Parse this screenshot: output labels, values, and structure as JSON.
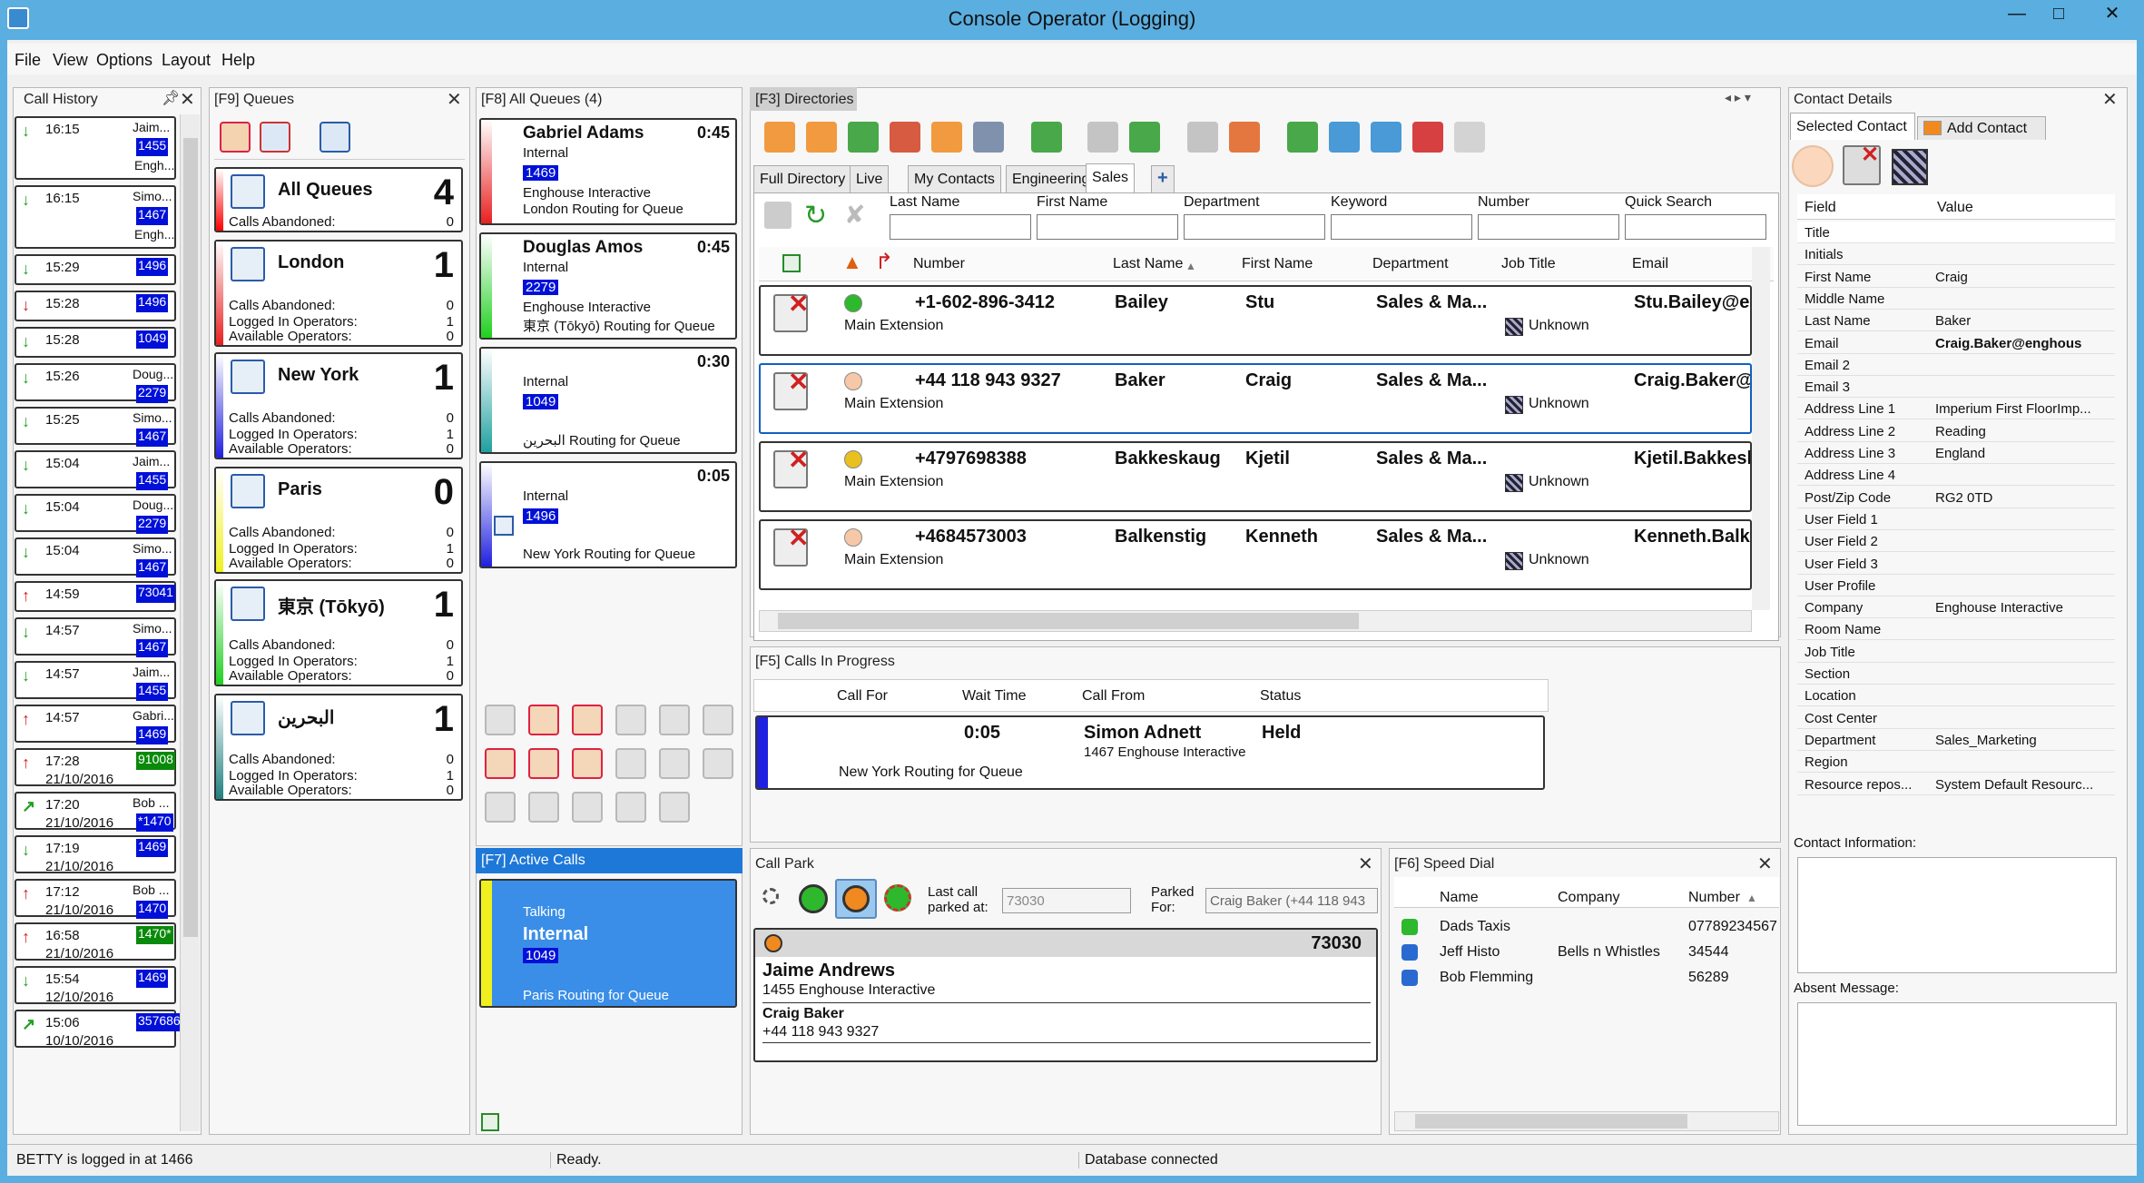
{
  "window": {
    "title": "Console Operator (Logging)",
    "minimize": "—",
    "maximize": "□",
    "close": "✕"
  },
  "menu": [
    "File",
    "View",
    "Options",
    "Layout",
    "Help"
  ],
  "call_history": {
    "title": "Call History",
    "items": [
      {
        "dir": "in",
        "time": "16:15",
        "name": "Jaim...",
        "badge": "1455",
        "sub": "Engh..."
      },
      {
        "dir": "in",
        "time": "16:15",
        "name": "Simo...",
        "badge": "1467",
        "sub": "Engh..."
      },
      {
        "dir": "in",
        "time": "15:29",
        "badge": "1496"
      },
      {
        "dir": "in-red",
        "time": "15:28",
        "badge": "1496"
      },
      {
        "dir": "in",
        "time": "15:28",
        "badge": "1049"
      },
      {
        "dir": "in",
        "time": "15:26",
        "name": "Doug...",
        "badge": "2279"
      },
      {
        "dir": "in",
        "time": "15:25",
        "name": "Simo...",
        "badge": "1467"
      },
      {
        "dir": "in",
        "time": "15:04",
        "name": "Jaim...",
        "badge": "1455"
      },
      {
        "dir": "in",
        "time": "15:04",
        "name": "Doug...",
        "badge": "2279"
      },
      {
        "dir": "in",
        "time": "15:04",
        "name": "Simo...",
        "badge": "1467"
      },
      {
        "dir": "out",
        "time": "14:59",
        "badge": "73041"
      },
      {
        "dir": "in",
        "time": "14:57",
        "name": "Simo...",
        "badge": "1467"
      },
      {
        "dir": "in",
        "time": "14:57",
        "name": "Jaim...",
        "badge": "1455"
      },
      {
        "dir": "out",
        "time": "14:57",
        "name": "Gabri...",
        "badge": "1469"
      },
      {
        "dir": "out",
        "time": "17:28",
        "date": "21/10/2016",
        "badge": "91008",
        "badge_color": "#0a8a0a"
      },
      {
        "dir": "out-green",
        "time": "17:20",
        "date": "21/10/2016",
        "name": "Bob ...",
        "badge": "*1470"
      },
      {
        "dir": "in",
        "time": "17:19",
        "date": "21/10/2016",
        "badge": "1469"
      },
      {
        "dir": "out",
        "time": "17:12",
        "date": "21/10/2016",
        "name": "Bob ...",
        "badge": "1470"
      },
      {
        "dir": "out",
        "time": "16:58",
        "date": "21/10/2016",
        "badge": "1470*",
        "badge_color": "#0a8a0a"
      },
      {
        "dir": "in",
        "time": "15:54",
        "date": "12/10/2016",
        "badge": "1469"
      },
      {
        "dir": "out-green",
        "time": "15:06",
        "date": "10/10/2016",
        "badge": "357686"
      }
    ]
  },
  "queues": {
    "title": "[F9] Queues",
    "labels": {
      "abandoned": "Calls Abandoned:",
      "logged": "Logged In Operators:",
      "available": "Available Operators:"
    },
    "items": [
      {
        "name": "All Queues",
        "count": "4",
        "abandoned": "0",
        "color": "#ff0000",
        "all": true
      },
      {
        "name": "London",
        "count": "1",
        "abandoned": "0",
        "logged": "1",
        "available": "0",
        "color": "#e82020"
      },
      {
        "name": "New York",
        "count": "1",
        "abandoned": "0",
        "logged": "1",
        "available": "0",
        "color": "#2020e0"
      },
      {
        "name": "Paris",
        "count": "0",
        "abandoned": "0",
        "logged": "1",
        "available": "0",
        "color": "#f0f020"
      },
      {
        "name": "東京 (Tōkyō)",
        "count": "1",
        "abandoned": "0",
        "logged": "1",
        "available": "0",
        "color": "#20d020"
      },
      {
        "name": "البحرين",
        "count": "1",
        "abandoned": "0",
        "logged": "1",
        "available": "0",
        "color": "#208080"
      }
    ]
  },
  "all_queues": {
    "title": "[F8] All Queues (4)",
    "items": [
      {
        "name": "Gabriel Adams",
        "time": "0:45",
        "type": "Internal",
        "badge": "1469",
        "company": "Enghouse Interactive",
        "route": "London Routing for Queue",
        "color": "#e82020"
      },
      {
        "name": "Douglas Amos",
        "time": "0:45",
        "type": "Internal",
        "badge": "2279",
        "company": "Enghouse Interactive",
        "route": "東京 (Tōkyō) Routing for Queue",
        "color": "#20d020"
      },
      {
        "name": "",
        "time": "0:30",
        "type": "Internal",
        "badge": "1049",
        "company": "",
        "route": "البحرين Routing for Queue",
        "color": "#20a0a0"
      },
      {
        "name": "",
        "time": "0:05",
        "type": "Internal",
        "badge": "1496",
        "company": "",
        "route": "New York Routing for Queue",
        "color": "#2020e0"
      }
    ]
  },
  "active_calls": {
    "title": "[F7] Active Calls",
    "status": "Talking",
    "type": "Internal",
    "badge": "1049",
    "route": "Paris Routing for Queue"
  },
  "directories": {
    "title": "[F3] Directories",
    "tabs": [
      "Full Directory",
      "Live",
      "My Contacts",
      "Engineering",
      "Sales",
      "+"
    ],
    "active_tab": "Sales",
    "search_labels": [
      "Last Name",
      "First Name",
      "Department",
      "Keyword",
      "Number",
      "Quick Search"
    ],
    "columns": [
      "Number",
      "Last Name",
      "First Name",
      "Department",
      "Job Title",
      "Email"
    ],
    "rows": [
      {
        "led": "#2db82d",
        "number": "+1-602-896-3412",
        "last": "Bailey",
        "first": "Stu",
        "dept": "Sales & Ma...",
        "ext": "Main Extension",
        "job": "Unknown",
        "email": "Stu.Bailey@en"
      },
      {
        "led": "#f6c8a8",
        "number": "+44 118 943 9327",
        "last": "Baker",
        "first": "Craig",
        "dept": "Sales & Ma...",
        "ext": "Main Extension",
        "job": "Unknown",
        "email": "Craig.Baker@e"
      },
      {
        "led": "#e8c020",
        "number": "+4797698388",
        "last": "Bakkeskaug",
        "first": "Kjetil",
        "dept": "Sales & Ma...",
        "ext": "Main Extension",
        "job": "Unknown",
        "email": "Kjetil.Bakkesk"
      },
      {
        "led": "#f6c8a8",
        "number": "+4684573003",
        "last": "Balkenstig",
        "first": "Kenneth",
        "dept": "Sales & Ma...",
        "ext": "Main Extension",
        "job": "Unknown",
        "email": "Kenneth.Balke"
      }
    ]
  },
  "calls_in_progress": {
    "title": "[F5] Calls In Progress",
    "columns": [
      "Call For",
      "Wait Time",
      "Call From",
      "Status"
    ],
    "row": {
      "wait": "0:05",
      "from_name": "Simon Adnett",
      "from_detail": "1467 Enghouse Interactive",
      "status": "Held",
      "route": "New York Routing for Queue"
    }
  },
  "call_park": {
    "title": "Call Park",
    "last_call_label": "Last call parked at:",
    "last_call_value": "73030",
    "parked_for_label": "Parked For:",
    "parked_for_value": "Craig Baker (+44 118 943",
    "entry": {
      "number": "73030",
      "caller": "Jaime Andrews",
      "caller_detail": "1455 Enghouse Interactive",
      "target": "Craig Baker",
      "target_number": "+44 118 943 9327"
    }
  },
  "speed_dial": {
    "title": "[F6] Speed Dial",
    "columns": [
      "Name",
      "Company",
      "Number"
    ],
    "rows": [
      {
        "name": "Dads Taxis",
        "company": "",
        "number": "07789234567"
      },
      {
        "name": "Jeff Histo",
        "company": "Bells n Whistles",
        "number": "34544"
      },
      {
        "name": "Bob Flemming",
        "company": "",
        "number": "56289"
      }
    ]
  },
  "contact_details": {
    "title": "Contact Details",
    "tabs": [
      "Selected Contact",
      "Add Contact"
    ],
    "columns": [
      "Field",
      "Value"
    ],
    "fields": [
      {
        "f": "Title",
        "v": ""
      },
      {
        "f": "Initials",
        "v": ""
      },
      {
        "f": "First Name",
        "v": "Craig"
      },
      {
        "f": "Middle Name",
        "v": ""
      },
      {
        "f": "Last Name",
        "v": "Baker"
      },
      {
        "f": "Email",
        "v": "Craig.Baker@enghous"
      },
      {
        "f": "Email 2",
        "v": ""
      },
      {
        "f": "Email 3",
        "v": ""
      },
      {
        "f": "Address Line 1",
        "v": "Imperium First FloorImp..."
      },
      {
        "f": "Address Line 2",
        "v": "Reading"
      },
      {
        "f": "Address Line 3",
        "v": "England"
      },
      {
        "f": "Address Line 4",
        "v": ""
      },
      {
        "f": "Post/Zip Code",
        "v": "RG2 0TD"
      },
      {
        "f": "User Field 1",
        "v": ""
      },
      {
        "f": "User Field 2",
        "v": ""
      },
      {
        "f": "User Field 3",
        "v": ""
      },
      {
        "f": "User Profile",
        "v": ""
      },
      {
        "f": "Company",
        "v": "Enghouse Interactive"
      },
      {
        "f": "Room Name",
        "v": ""
      },
      {
        "f": "Job Title",
        "v": ""
      },
      {
        "f": "Section",
        "v": ""
      },
      {
        "f": "Location",
        "v": ""
      },
      {
        "f": "Cost Center",
        "v": ""
      },
      {
        "f": "Department",
        "v": "Sales_Marketing"
      },
      {
        "f": "Region",
        "v": ""
      },
      {
        "f": "Resource repos...",
        "v": "System Default Resourc..."
      }
    ],
    "contact_info_label": "Contact Information:",
    "absent_label": "Absent Message:"
  },
  "status_bar": {
    "login": "BETTY is logged in at 1466",
    "state": "Ready.",
    "db": "Database connected"
  }
}
